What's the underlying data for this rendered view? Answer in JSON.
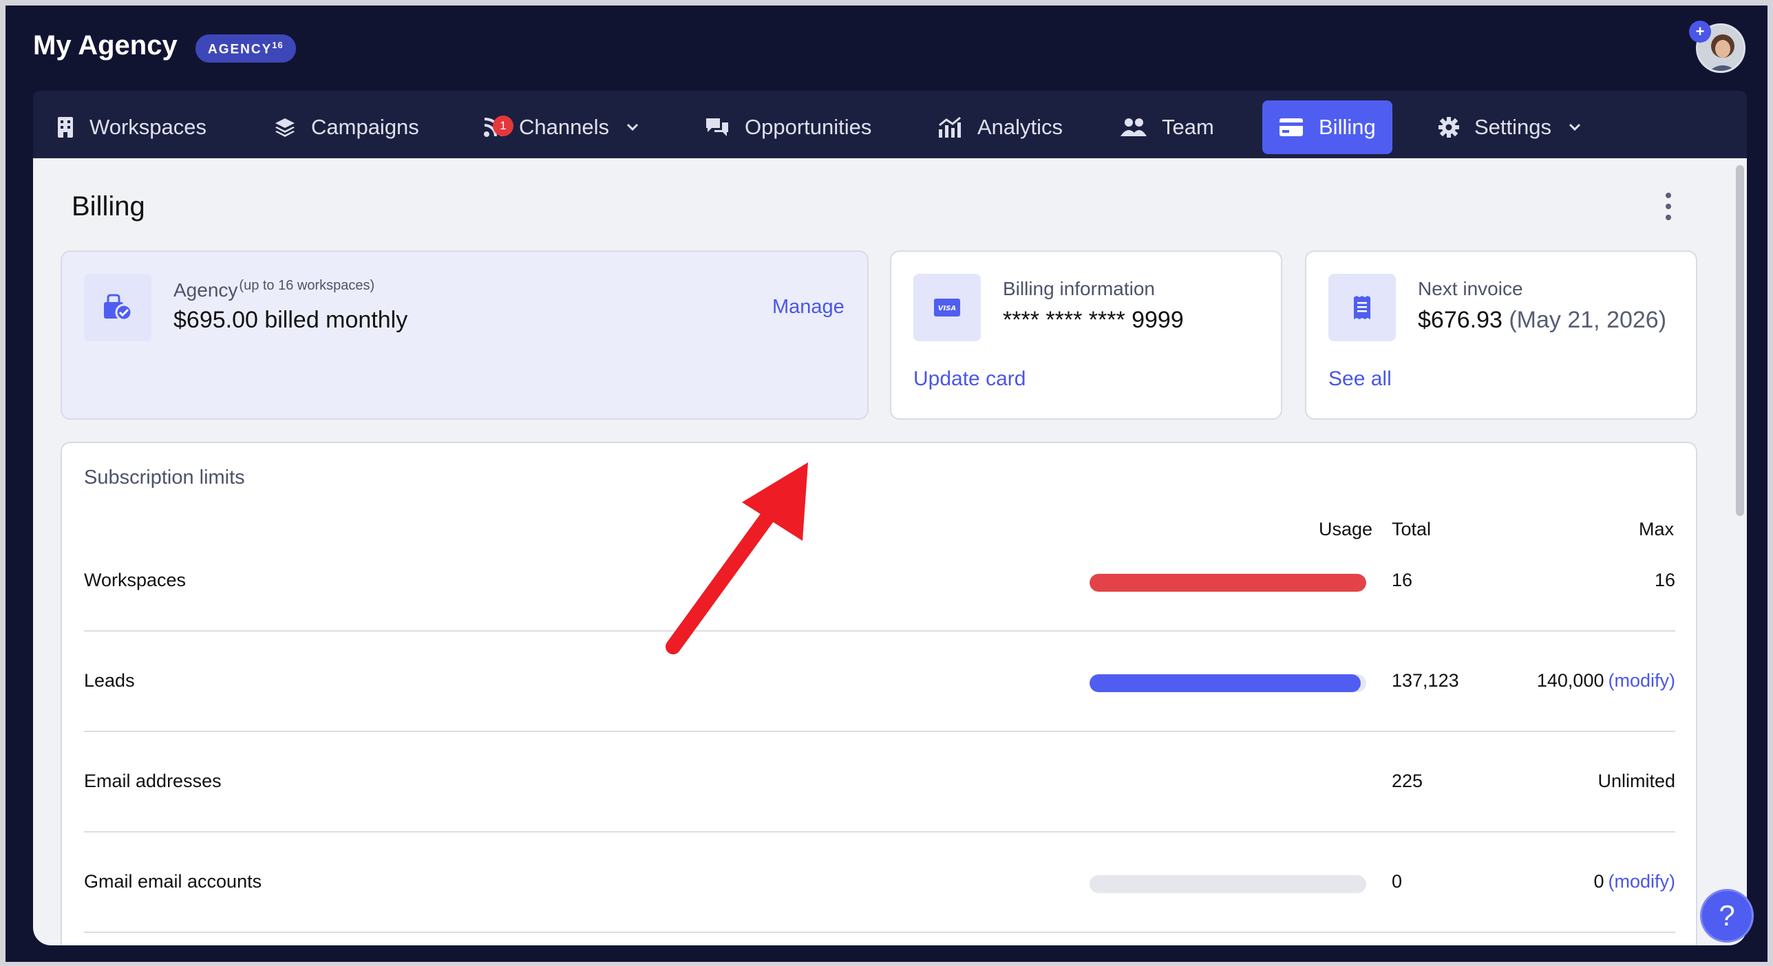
{
  "app": {
    "title": "My Agency",
    "plan_badge": "AGENCY",
    "plan_badge_sup": "16",
    "avatar_plus": "+"
  },
  "nav": {
    "items": [
      {
        "label": "Workspaces",
        "icon": "building-icon"
      },
      {
        "label": "Campaigns",
        "icon": "layers-icon"
      },
      {
        "label": "Channels",
        "icon": "rss-icon",
        "badge": "1",
        "has_dropdown": true
      },
      {
        "label": "Opportunities",
        "icon": "chat-bubbles-icon"
      },
      {
        "label": "Analytics",
        "icon": "chart-icon"
      },
      {
        "label": "Team",
        "icon": "users-icon"
      },
      {
        "label": "Billing",
        "icon": "credit-card-icon",
        "active": true
      },
      {
        "label": "Settings",
        "icon": "gear-icon",
        "has_dropdown": true
      }
    ]
  },
  "page": {
    "title": "Billing"
  },
  "plan_card": {
    "label": "Agency",
    "label_sup": "(up to 16 workspaces)",
    "value": "$695.00 billed monthly",
    "manage_link": "Manage"
  },
  "billing_card": {
    "label": "Billing information",
    "card_number": "**** **** **** 9999",
    "card_brand": "VISA",
    "link": "Update card"
  },
  "invoice_card": {
    "label": "Next invoice",
    "amount": "$676.93",
    "date": "(May 21, 2026)",
    "link": "See all"
  },
  "limits": {
    "title": "Subscription limits",
    "headers": {
      "usage": "Usage",
      "total": "Total",
      "max": "Max"
    },
    "rows": [
      {
        "name": "Workspaces",
        "usage_fraction": 1.0,
        "bar_color": "#e34348",
        "total": "16",
        "max": "16",
        "modify": ""
      },
      {
        "name": "Leads",
        "usage_fraction": 0.979,
        "bar_color": "#4f5ef0",
        "total": "137,123",
        "max": "140,000",
        "modify": "(modify)"
      },
      {
        "name": "Email addresses",
        "usage_fraction": null,
        "bar_color": "",
        "total": "225",
        "max": "Unlimited",
        "modify": ""
      },
      {
        "name": "Gmail email accounts",
        "usage_fraction": 0,
        "bar_color": "#e6e7ec",
        "total": "0",
        "max": "0",
        "modify": "(modify)"
      }
    ]
  },
  "help_button": "?",
  "colors": {
    "accent": "#4f5ef0",
    "danger": "#e34348",
    "header_bg": "#111431",
    "annotation_arrow": "#ee1c24"
  }
}
